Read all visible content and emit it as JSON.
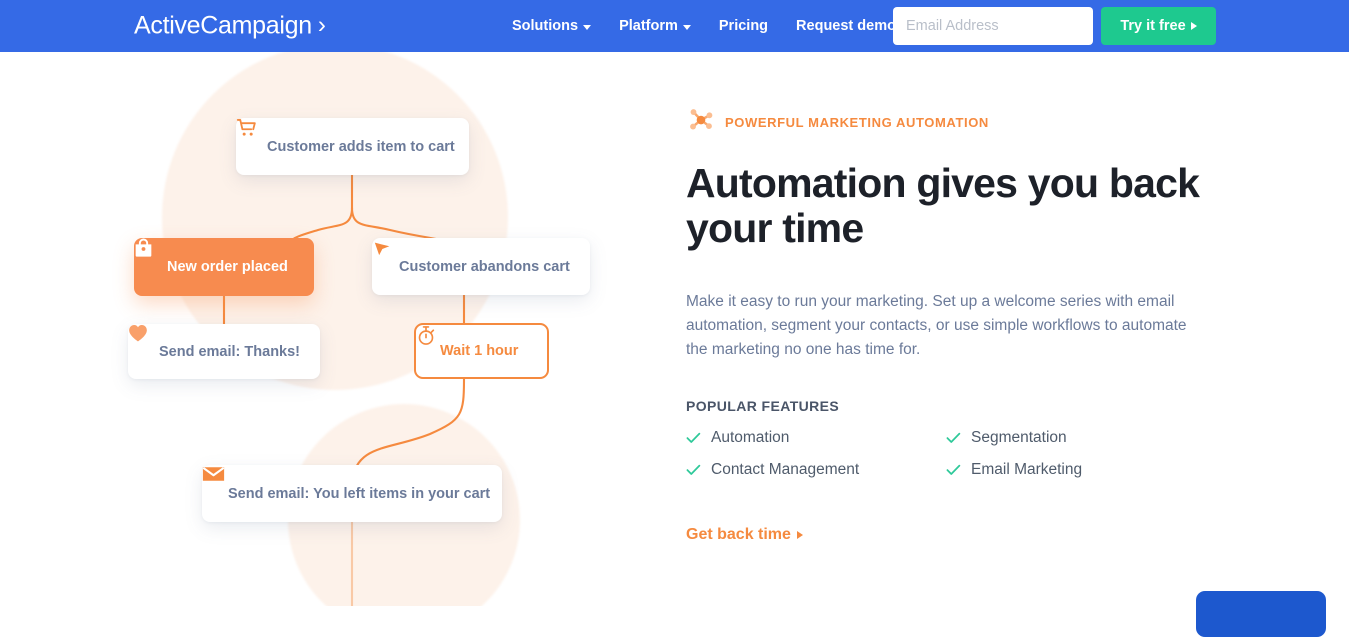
{
  "navbar": {
    "logo_text": "ActiveCampaign",
    "logo_chevron": "›",
    "links": [
      {
        "label": "Solutions",
        "has_caret": true
      },
      {
        "label": "Platform",
        "has_caret": true
      },
      {
        "label": "Pricing",
        "has_caret": false
      },
      {
        "label": "Request demo",
        "has_caret": false
      }
    ],
    "email_placeholder": "Email Address",
    "email_value": "",
    "cta_label": "Try it free",
    "colors": {
      "background": "#356AE6",
      "cta": "#1EC98F",
      "text": "#FFFFFF"
    }
  },
  "flow": {
    "nodes": [
      {
        "id": "add-cart",
        "label": "Customer adds item to cart",
        "icon": "shopping-cart-icon",
        "style": "card"
      },
      {
        "id": "new-order",
        "label": "New order placed",
        "icon": "shopping-bag-icon",
        "style": "primary"
      },
      {
        "id": "abandon",
        "label": "Customer abandons cart",
        "icon": "cursor-arrow-icon",
        "style": "card"
      },
      {
        "id": "thanks",
        "label": "Send email: Thanks!",
        "icon": "heart-icon",
        "style": "card"
      },
      {
        "id": "wait",
        "label": "Wait 1 hour",
        "icon": "stopwatch-icon",
        "style": "outlined"
      },
      {
        "id": "send-left",
        "label": "Send email:  You left items in your cart",
        "icon": "envelope-icon",
        "style": "card"
      }
    ],
    "colors": {
      "connector": "#F58A3F",
      "primary_fill": "#F78B4F",
      "card_text": "#6B7A99",
      "blob": "#FDF2EA"
    }
  },
  "content": {
    "eyebrow": "POWERFUL MARKETING AUTOMATION",
    "eyebrow_icon": "network-nodes-icon",
    "headline": "Automation gives you back your time",
    "blurb": "Make it easy to run your marketing. Set up a welcome series with email automation, segment your contacts, or use simple workflows to automate the marketing no one has time for.",
    "features_title": "POPULAR FEATURES",
    "features": [
      "Automation",
      "Segmentation",
      "Contact Management",
      "Email Marketing"
    ],
    "cta_link": "Get back time",
    "colors": {
      "accent": "#F58A3F",
      "heading": "#1D2129",
      "body": "#6B7A99",
      "check": "#2FC99A"
    }
  },
  "chat_widget": {
    "color": "#1D58CE"
  }
}
